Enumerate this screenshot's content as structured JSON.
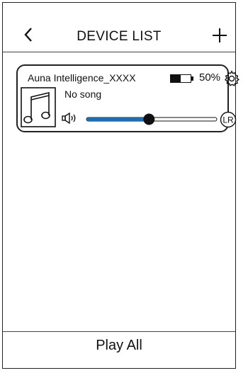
{
  "header": {
    "title": "DEVICE LIST",
    "back_icon": "chevron-left-icon",
    "add_icon": "plus-icon"
  },
  "device": {
    "name": "Auna Intelligence_XXXX",
    "battery_percent": 50,
    "battery_label": "50%",
    "song": "No song",
    "volume_level": 0.48,
    "channel_label": "LR",
    "icons": {
      "settings": "gear-icon",
      "album": "music-note-icon",
      "speaker": "speaker-icon"
    }
  },
  "footer": {
    "play_all_label": "Play All"
  },
  "colors": {
    "slider_fill": "#1e6fb0",
    "line": "#222222"
  }
}
